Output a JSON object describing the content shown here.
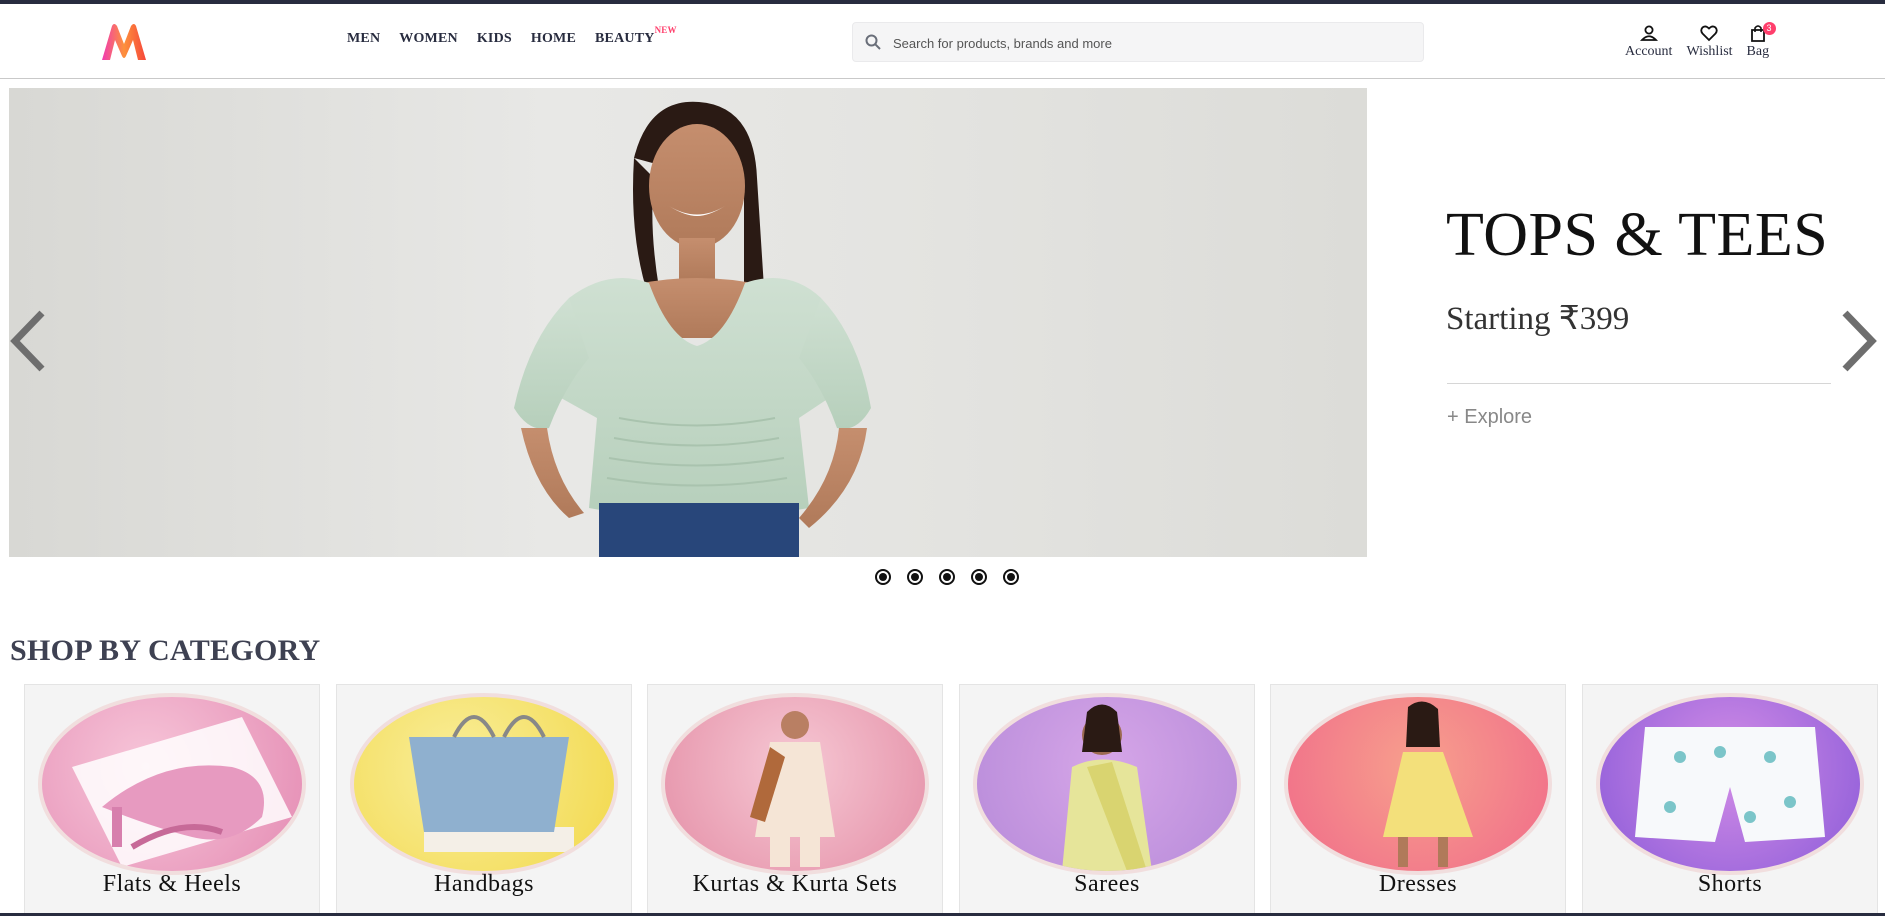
{
  "header": {
    "logo_alt": "Myntra logo",
    "nav": [
      {
        "label": "MEN"
      },
      {
        "label": "WOMEN"
      },
      {
        "label": "KIDS"
      },
      {
        "label": "HOME"
      },
      {
        "label": "BEAUTY",
        "tag": "NEW"
      }
    ],
    "search": {
      "placeholder": "Search for products, brands and more",
      "value": ""
    },
    "actions": [
      {
        "label": "Account",
        "icon": "user-icon"
      },
      {
        "label": "Wishlist",
        "icon": "heart-icon"
      },
      {
        "label": "Bag",
        "icon": "bag-icon",
        "badge": "3"
      }
    ]
  },
  "hero": {
    "headline": "TOPS & TEES",
    "subline": "Starting ₹399",
    "cta": "+ Explore",
    "slide_count": 5,
    "prev_icon": "chevron-left-icon",
    "next_icon": "chevron-right-icon"
  },
  "categories": {
    "title": "SHOP BY CATEGORY",
    "items": [
      {
        "label": "Flats & Heels",
        "bg": [
          "#f7c6d9",
          "#e48bb3"
        ]
      },
      {
        "label": "Handbags",
        "bg": [
          "#f9ee9a",
          "#f2d84a"
        ]
      },
      {
        "label": "Kurtas & Kurta Sets",
        "bg": [
          "#f6c8d4",
          "#e48ea6"
        ]
      },
      {
        "label": "Sarees",
        "bg": [
          "#d6a6e8",
          "#b68ad9"
        ]
      },
      {
        "label": "Dresses",
        "bg": [
          "#f7a08c",
          "#f06a8a"
        ]
      },
      {
        "label": "Shorts",
        "bg": [
          "#d38de6",
          "#8b5bd9"
        ]
      }
    ]
  },
  "colors": {
    "brand": "#ff3f6c",
    "text": "#282c3f"
  }
}
